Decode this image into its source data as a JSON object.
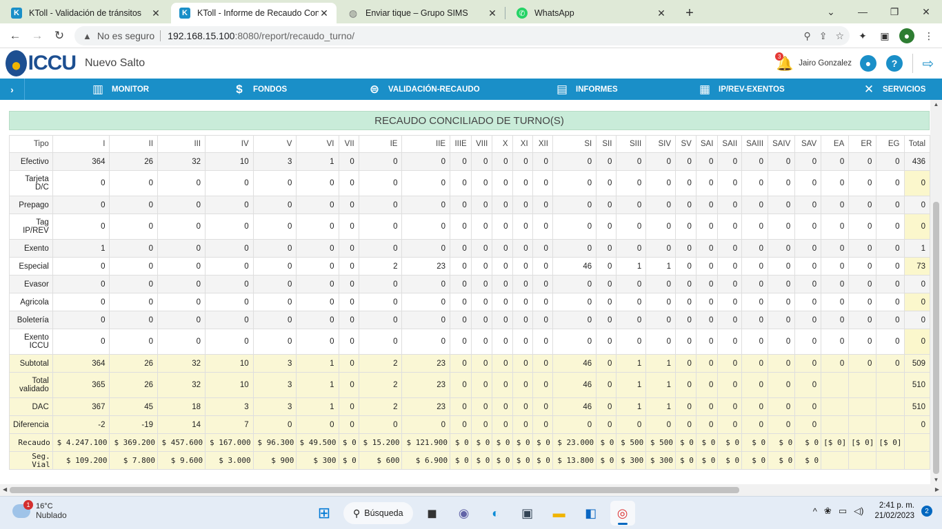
{
  "browser": {
    "tabs": [
      {
        "title": "KToll - Validación de tránsitos",
        "favicon": "K",
        "favicon_color": "#1a8fc8",
        "active": false
      },
      {
        "title": "KToll - Informe de Recaudo Conc",
        "favicon": "K",
        "favicon_color": "#1a8fc8",
        "active": true
      },
      {
        "title": "Enviar tique – Grupo SIMS",
        "favicon": "◍",
        "favicon_color": "#777777",
        "active": false
      },
      {
        "title": "WhatsApp",
        "favicon": "✆",
        "favicon_color": "#25d366",
        "active": false
      }
    ],
    "security_label": "No es seguro",
    "url_host": "192.168.15.100",
    "url_path": ":8080/report/recaudo_turno/"
  },
  "app": {
    "logo_text": "ICCU",
    "site_name": "Nuevo Salto",
    "notifications_count": "3",
    "user_name": "Jairo Gonzalez",
    "nav": [
      {
        "label": "MONITOR",
        "icon": "monitor-icon"
      },
      {
        "label": "FONDOS",
        "icon": "money-bag-icon"
      },
      {
        "label": "VALIDACIÓN-RECAUDO",
        "icon": "validation-search-icon"
      },
      {
        "label": "INFORMES",
        "icon": "reports-chart-icon"
      },
      {
        "label": "IP/REV-EXENTOS",
        "icon": "chip-icon"
      },
      {
        "label": "SERVICIOS",
        "icon": "tools-icon"
      }
    ]
  },
  "report": {
    "title": "RECAUDO CONCILIADO DE TURNO(S)",
    "columns": [
      "Tipo",
      "I",
      "II",
      "III",
      "IV",
      "V",
      "VI",
      "VII",
      "IE",
      "IIE",
      "IIIE",
      "VIII",
      "X",
      "XI",
      "XII",
      "SI",
      "SII",
      "SIII",
      "SIV",
      "SV",
      "SAI",
      "SAII",
      "SAIII",
      "SAIV",
      "SAV",
      "EA",
      "ER",
      "EG",
      "Total"
    ],
    "rows": [
      {
        "label": "Efectivo",
        "values": [
          "364",
          "26",
          "32",
          "10",
          "3",
          "1",
          "0",
          "0",
          "0",
          "0",
          "0",
          "0",
          "0",
          "0",
          "0",
          "0",
          "0",
          "0",
          "0",
          "0",
          "0",
          "0",
          "0",
          "0",
          "0",
          "0",
          "0",
          "436"
        ]
      },
      {
        "label": "Tarjeta D/C",
        "values": [
          "0",
          "0",
          "0",
          "0",
          "0",
          "0",
          "0",
          "0",
          "0",
          "0",
          "0",
          "0",
          "0",
          "0",
          "0",
          "0",
          "0",
          "0",
          "0",
          "0",
          "0",
          "0",
          "0",
          "0",
          "0",
          "0",
          "0",
          "0"
        ]
      },
      {
        "label": "Prepago",
        "values": [
          "0",
          "0",
          "0",
          "0",
          "0",
          "0",
          "0",
          "0",
          "0",
          "0",
          "0",
          "0",
          "0",
          "0",
          "0",
          "0",
          "0",
          "0",
          "0",
          "0",
          "0",
          "0",
          "0",
          "0",
          "0",
          "0",
          "0",
          "0"
        ]
      },
      {
        "label": "Tag IP/REV",
        "values": [
          "0",
          "0",
          "0",
          "0",
          "0",
          "0",
          "0",
          "0",
          "0",
          "0",
          "0",
          "0",
          "0",
          "0",
          "0",
          "0",
          "0",
          "0",
          "0",
          "0",
          "0",
          "0",
          "0",
          "0",
          "0",
          "0",
          "0",
          "0"
        ]
      },
      {
        "label": "Exento",
        "values": [
          "1",
          "0",
          "0",
          "0",
          "0",
          "0",
          "0",
          "0",
          "0",
          "0",
          "0",
          "0",
          "0",
          "0",
          "0",
          "0",
          "0",
          "0",
          "0",
          "0",
          "0",
          "0",
          "0",
          "0",
          "0",
          "0",
          "0",
          "1"
        ]
      },
      {
        "label": "Especial",
        "values": [
          "0",
          "0",
          "0",
          "0",
          "0",
          "0",
          "0",
          "2",
          "23",
          "0",
          "0",
          "0",
          "0",
          "0",
          "46",
          "0",
          "1",
          "1",
          "0",
          "0",
          "0",
          "0",
          "0",
          "0",
          "0",
          "0",
          "0",
          "73"
        ]
      },
      {
        "label": "Evasor",
        "values": [
          "0",
          "0",
          "0",
          "0",
          "0",
          "0",
          "0",
          "0",
          "0",
          "0",
          "0",
          "0",
          "0",
          "0",
          "0",
          "0",
          "0",
          "0",
          "0",
          "0",
          "0",
          "0",
          "0",
          "0",
          "0",
          "0",
          "0",
          "0"
        ]
      },
      {
        "label": "Agricola",
        "values": [
          "0",
          "0",
          "0",
          "0",
          "0",
          "0",
          "0",
          "0",
          "0",
          "0",
          "0",
          "0",
          "0",
          "0",
          "0",
          "0",
          "0",
          "0",
          "0",
          "0",
          "0",
          "0",
          "0",
          "0",
          "0",
          "0",
          "0",
          "0"
        ]
      },
      {
        "label": "Boletería",
        "values": [
          "0",
          "0",
          "0",
          "0",
          "0",
          "0",
          "0",
          "0",
          "0",
          "0",
          "0",
          "0",
          "0",
          "0",
          "0",
          "0",
          "0",
          "0",
          "0",
          "0",
          "0",
          "0",
          "0",
          "0",
          "0",
          "0",
          "0",
          "0"
        ]
      },
      {
        "label": "Exento ICCU",
        "values": [
          "0",
          "0",
          "0",
          "0",
          "0",
          "0",
          "0",
          "0",
          "0",
          "0",
          "0",
          "0",
          "0",
          "0",
          "0",
          "0",
          "0",
          "0",
          "0",
          "0",
          "0",
          "0",
          "0",
          "0",
          "0",
          "0",
          "0",
          "0"
        ]
      },
      {
        "label": "Subtotal",
        "values": [
          "364",
          "26",
          "32",
          "10",
          "3",
          "1",
          "0",
          "2",
          "23",
          "0",
          "0",
          "0",
          "0",
          "0",
          "46",
          "0",
          "1",
          "1",
          "0",
          "0",
          "0",
          "0",
          "0",
          "0",
          "0",
          "0",
          "0",
          "509"
        ]
      },
      {
        "label": "Total validado",
        "values": [
          "365",
          "26",
          "32",
          "10",
          "3",
          "1",
          "0",
          "2",
          "23",
          "0",
          "0",
          "0",
          "0",
          "0",
          "46",
          "0",
          "1",
          "1",
          "0",
          "0",
          "0",
          "0",
          "0",
          "0",
          "",
          "",
          "",
          "510"
        ]
      },
      {
        "label": "DAC",
        "values": [
          "367",
          "45",
          "18",
          "3",
          "3",
          "1",
          "0",
          "2",
          "23",
          "0",
          "0",
          "0",
          "0",
          "0",
          "46",
          "0",
          "1",
          "1",
          "0",
          "0",
          "0",
          "0",
          "0",
          "0",
          "",
          "",
          "",
          "510"
        ]
      },
      {
        "label": "Diferencia",
        "values": [
          "-2",
          "-19",
          "14",
          "7",
          "0",
          "0",
          "0",
          "0",
          "0",
          "0",
          "0",
          "0",
          "0",
          "0",
          "0",
          "0",
          "0",
          "0",
          "0",
          "0",
          "0",
          "0",
          "0",
          "0",
          "",
          "",
          "",
          "0"
        ]
      },
      {
        "label": "Recaudo",
        "values": [
          "$ 4.247.100",
          "$ 369.200",
          "$ 457.600",
          "$ 167.000",
          "$ 96.300",
          "$ 49.500",
          "$ 0",
          "$ 15.200",
          "$ 121.900",
          "$ 0",
          "$ 0",
          "$ 0",
          "$ 0",
          "$ 0",
          "$ 23.000",
          "$ 0",
          "$ 500",
          "$ 500",
          "$ 0",
          "$ 0",
          "$ 0",
          "$ 0",
          "$ 0",
          "$ 0",
          "[$ 0]",
          "[$ 0]",
          "[$ 0]",
          ""
        ]
      },
      {
        "label": "Seg. Vial",
        "values": [
          "$ 109.200",
          "$ 7.800",
          "$ 9.600",
          "$ 3.000",
          "$ 900",
          "$ 300",
          "$ 0",
          "$ 600",
          "$ 6.900",
          "$ 0",
          "$ 0",
          "$ 0",
          "$ 0",
          "$ 0",
          "$ 13.800",
          "$ 0",
          "$ 300",
          "$ 300",
          "$ 0",
          "$ 0",
          "$ 0",
          "$ 0",
          "$ 0",
          "$ 0",
          "",
          "",
          "",
          ""
        ]
      }
    ]
  },
  "taskbar": {
    "weather_temp": "16°C",
    "weather_desc": "Nublado",
    "weather_badge": "1",
    "search_label": "Búsqueda",
    "time": "2:41 p. m.",
    "date": "21/02/2023",
    "notif_count": "2"
  },
  "colors": {
    "brand": "#1a8fc8",
    "panel_header": "#c9ecd9",
    "summary_row": "#faf7d5",
    "tab_strip": "#dfe9d7"
  }
}
